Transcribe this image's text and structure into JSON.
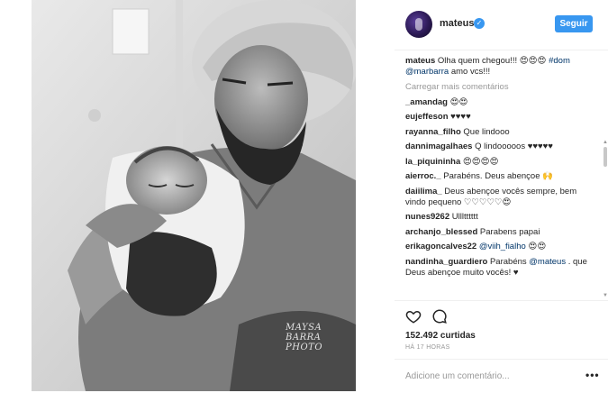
{
  "post": {
    "watermark": "MAYSA BARRA PHOTO"
  },
  "header": {
    "username": "mateus",
    "verified_glyph": "✓",
    "follow_label": "Seguir"
  },
  "caption": {
    "user": "mateus",
    "text": " Olha quem chegou!!! 😍😍😍 ",
    "hashtag": "#dom",
    "mention": "@marbarra",
    "text_after": " amo vcs!!!"
  },
  "load_more_label": "Carregar mais comentários",
  "comments": [
    {
      "user": "_amandag",
      "text": " 😍😍"
    },
    {
      "user": "eujeffeson",
      "text": " ♥♥♥♥"
    },
    {
      "user": "rayanna_filho",
      "text": " Que lindooo"
    },
    {
      "user": "dannimagalhaes",
      "text": " Q lindooooos ♥♥♥♥♥"
    },
    {
      "user": "la_piquininha",
      "text": " 😍😍😍😍"
    },
    {
      "user": "aierroc._",
      "text": " Parabéns. Deus abençoe 🙌"
    },
    {
      "user": "daiilima_",
      "text": " Deus abençoe vocês sempre, bem vindo pequeno ♡♡♡♡♡😍"
    },
    {
      "user": "nunes9262",
      "text": " Ullltttttt"
    },
    {
      "user": "archanjo_blessed",
      "text": " Parabens papai"
    },
    {
      "user": "erikagoncalves22",
      "text": " ",
      "mention": "@viih_fialho",
      "text_after": " 😍😍"
    },
    {
      "user": "nandinha_guardiero",
      "text": " Parabéns ",
      "mention": "@mateus",
      "text_after": " . que Deus abençoe muito vocês! ♥"
    }
  ],
  "actions": {
    "like_icon": "heart-outline-icon",
    "comment_icon": "speech-bubble-icon",
    "likes_text": "152.492 curtidas",
    "time_text": "HÁ 17 HORAS"
  },
  "comment_input": {
    "placeholder": "Adicione um comentário...",
    "more_label": "•••"
  },
  "colors": {
    "accent": "#3897f0",
    "link": "#003569",
    "muted": "#999999",
    "text": "#262626"
  }
}
